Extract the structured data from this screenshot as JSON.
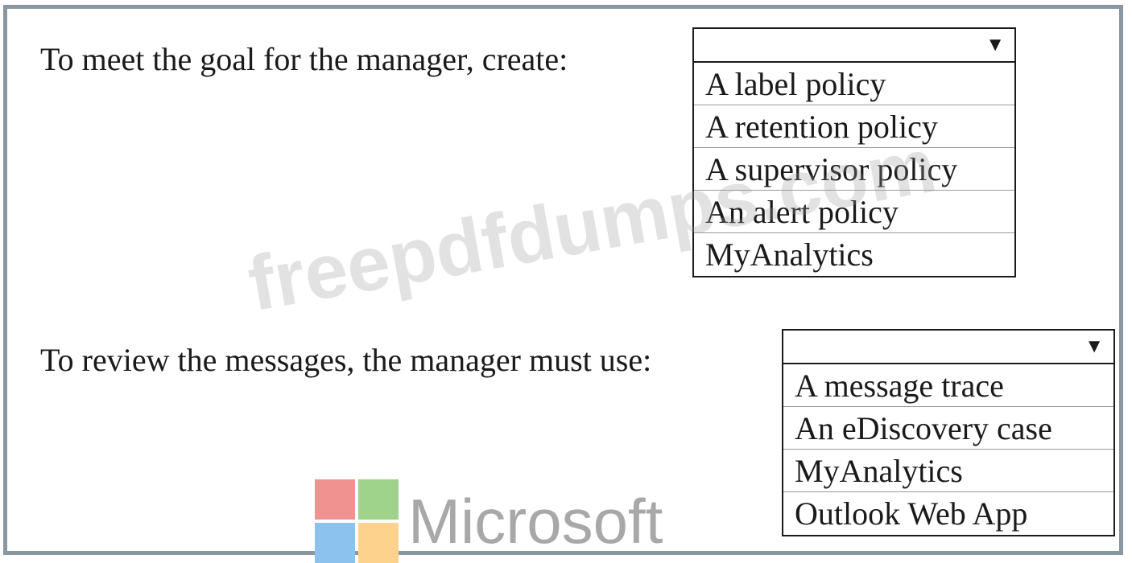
{
  "questions": [
    {
      "prompt": "To meet the goal for the manager, create:",
      "selected": "",
      "options": [
        "A label policy",
        "A retention policy",
        "A supervisor policy",
        "An alert policy",
        "MyAnalytics"
      ]
    },
    {
      "prompt": "To review the messages, the manager must use:",
      "selected": "",
      "options": [
        "A message trace",
        "An eDiscovery case",
        "MyAnalytics",
        "Outlook Web App"
      ]
    }
  ],
  "dropdown_arrow": "▼",
  "watermark": "freepdfdumps.com",
  "logo": {
    "text": "Microsoft",
    "icon": "microsoft-logo-icon",
    "colors": {
      "red": "#f0928f",
      "green": "#9fd28a",
      "blue": "#8cc2ee",
      "yellow": "#fcd28c"
    }
  },
  "colors": {
    "frame_border": "#8a97a3",
    "text": "#1a1a1a"
  }
}
